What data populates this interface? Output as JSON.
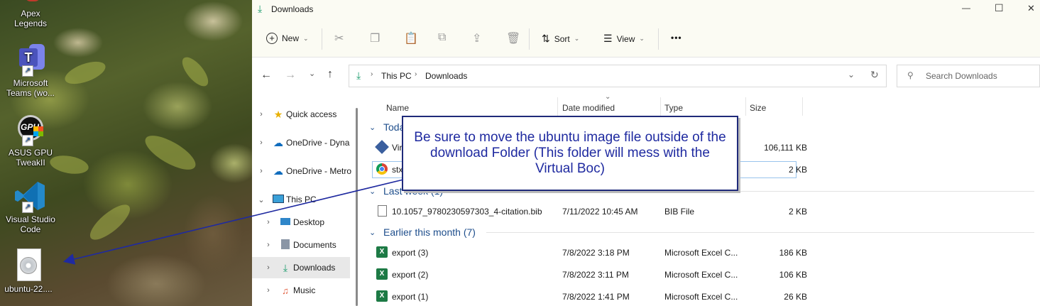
{
  "desktop": {
    "icons": [
      {
        "label": "Apex\nLegends",
        "icon": "apex-legends-icon"
      },
      {
        "label": "Microsoft\nTeams (wo...",
        "icon": "teams-icon"
      },
      {
        "label": "ASUS GPU\nTweakII",
        "icon": "gpu-tweak-icon"
      },
      {
        "label": "Visual Studio\nCode",
        "icon": "vscode-icon"
      },
      {
        "label": "ubuntu-22....",
        "icon": "disc-image-icon"
      }
    ]
  },
  "window": {
    "title": "Downloads",
    "controls": {
      "minimize": "—",
      "maximize": "☐",
      "close": "✕"
    }
  },
  "toolbar": {
    "new_label": "New",
    "sort_label": "Sort",
    "view_label": "View",
    "more_label": "•••"
  },
  "address": {
    "segments": [
      "This PC",
      "Downloads"
    ],
    "search_placeholder": "Search Downloads"
  },
  "nav": {
    "items": [
      {
        "label": "Quick access",
        "icon": "star-icon"
      },
      {
        "label": "OneDrive - Dyna",
        "icon": "cloud-icon"
      },
      {
        "label": "OneDrive - Metro",
        "icon": "cloud-icon"
      },
      {
        "label": "This PC",
        "icon": "pc-icon"
      },
      {
        "label": "Desktop",
        "icon": "desktop-folder-icon"
      },
      {
        "label": "Documents",
        "icon": "documents-icon"
      },
      {
        "label": "Downloads",
        "icon": "downloads-icon"
      },
      {
        "label": "Music",
        "icon": "music-icon"
      }
    ]
  },
  "columns": {
    "name": "Name",
    "date": "Date modified",
    "type": "Type",
    "size": "Size"
  },
  "groups": {
    "today": "Toda",
    "last_week": "Last week (1)",
    "earlier": "Earlier this month (7)"
  },
  "files": {
    "today": [
      {
        "name": "Vir",
        "date": "",
        "type": "",
        "size": "106,111 KB",
        "icon": "virtualbox-icon"
      },
      {
        "name": "stx",
        "date": "",
        "type": "",
        "size": "2 KB",
        "icon": "chrome-icon"
      }
    ],
    "last_week": [
      {
        "name": "10.1057_9780230597303_4-citation.bib",
        "date": "7/11/2022 10:45 AM",
        "type": "BIB File",
        "size": "2 KB",
        "icon": "file-icon"
      }
    ],
    "earlier": [
      {
        "name": "export (3)",
        "date": "7/8/2022 3:18 PM",
        "type": "Microsoft Excel C...",
        "size": "186 KB",
        "icon": "excel-icon"
      },
      {
        "name": "export (2)",
        "date": "7/8/2022 3:11 PM",
        "type": "Microsoft Excel C...",
        "size": "106 KB",
        "icon": "excel-icon"
      },
      {
        "name": "export (1)",
        "date": "7/8/2022 1:41 PM",
        "type": "Microsoft Excel C...",
        "size": "26 KB",
        "icon": "excel-icon"
      }
    ]
  },
  "callout": {
    "text": "Be sure to move the ubuntu image file outside of the download Folder (This folder will mess with the Virtual Boc)"
  },
  "colors": {
    "accent": "#1e4e8c",
    "callout_border": "#1f2a7a",
    "callout_text": "#1f2aa0",
    "arrow": "#1f2aa0"
  }
}
